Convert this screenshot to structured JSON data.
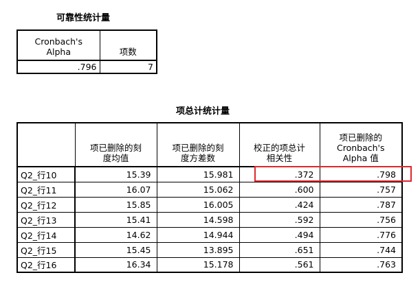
{
  "reliability": {
    "title": "可靠性统计量",
    "headers": [
      "Cronbach's\nAlpha",
      "项数"
    ],
    "values": [
      ".796",
      "7"
    ]
  },
  "item_total": {
    "title": "项总计统计量",
    "headers": [
      "",
      "项已删除的刻\n度均值",
      "项已删除的刻\n度方差数",
      "校正的项总计\n相关性",
      "项已删除的\nCronbach's\nAlpha 值"
    ],
    "rows": [
      {
        "label": "Q2_行10",
        "cells": [
          "15.39",
          "15.981",
          ".372",
          ".798"
        ]
      },
      {
        "label": "Q2_行11",
        "cells": [
          "16.07",
          "15.062",
          ".600",
          ".757"
        ]
      },
      {
        "label": "Q2_行12",
        "cells": [
          "15.85",
          "16.005",
          ".424",
          ".787"
        ]
      },
      {
        "label": "Q2_行13",
        "cells": [
          "15.41",
          "14.598",
          ".592",
          ".756"
        ]
      },
      {
        "label": "Q2_行14",
        "cells": [
          "14.62",
          "14.944",
          ".494",
          ".776"
        ]
      },
      {
        "label": "Q2_行15",
        "cells": [
          "15.45",
          "13.895",
          ".651",
          ".744"
        ]
      },
      {
        "label": "Q2_行16",
        "cells": [
          "16.34",
          "15.178",
          ".561",
          ".763"
        ]
      }
    ]
  },
  "highlight": {
    "color": "#e0252b",
    "row": "Q2_行10"
  }
}
